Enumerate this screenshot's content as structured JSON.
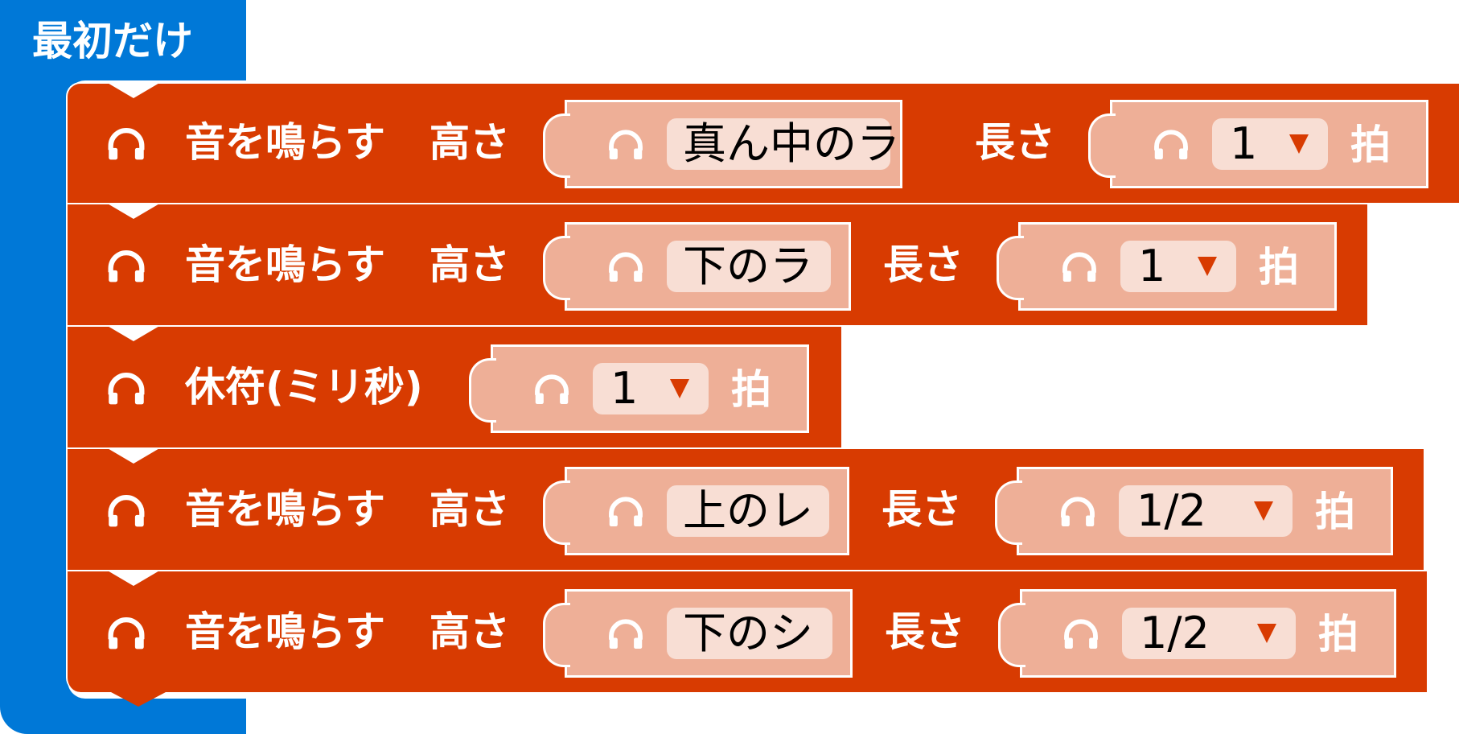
{
  "hat": {
    "title": "最初だけ",
    "color": "#0078d7"
  },
  "colors": {
    "statement": "#d83b01",
    "reporter": "#eeaf97",
    "field": "#f8ded4"
  },
  "blocks": [
    {
      "label": "音を鳴らす",
      "pitch_label": "高さ",
      "pitch_value": "真ん中のラ",
      "length_label": "長さ",
      "length_value": "1",
      "unit": "拍"
    },
    {
      "label": "音を鳴らす",
      "pitch_label": "高さ",
      "pitch_value": "下のラ",
      "length_label": "長さ",
      "length_value": "1",
      "unit": "拍"
    },
    {
      "label": "休符(ミリ秒)",
      "length_value": "1",
      "unit": "拍"
    },
    {
      "label": "音を鳴らす",
      "pitch_label": "高さ",
      "pitch_value": "上のレ",
      "length_label": "長さ",
      "length_value": "1/2",
      "unit": "拍"
    },
    {
      "label": "音を鳴らす",
      "pitch_label": "高さ",
      "pitch_value": "下のシ",
      "length_label": "長さ",
      "length_value": "1/2",
      "unit": "拍"
    }
  ],
  "icons": {
    "block": "headphones-icon"
  }
}
